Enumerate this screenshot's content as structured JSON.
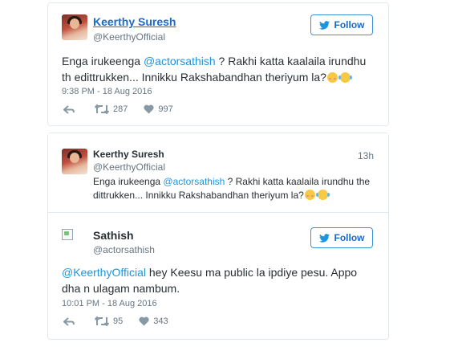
{
  "tweet1": {
    "name": "Keerthy Suresh",
    "handle": "@KeerthyOfficial",
    "follow_label": "Follow",
    "text_before": "Enga irukeenga ",
    "mention": "@actorsathish",
    "text_after": " ? Rakhi katta kaalaila irundhu th edittrukken... Innikku Rakshabandhan theriyum la?",
    "timestamp": "9:38 PM - 18 Aug 2016",
    "retweets": "287",
    "likes": "997"
  },
  "tweet2": {
    "quoted": {
      "name": "Keerthy Suresh",
      "handle": "@KeerthyOfficial",
      "relative_time": "13h",
      "text_before": "Enga irukeenga ",
      "mention": "@actorsathish",
      "text_after": " ? Rakhi katta kaalaila irundhu the dittrukken... Innikku Rakshabandhan theriyum la?"
    },
    "reply": {
      "name": "Sathish",
      "handle": "@actorsathish",
      "follow_label": "Follow",
      "mention": "@KeerthyOfficial",
      "text_after": " hey Keesu ma public la ipdiye pesu. Appo dha n ulagam nambum.",
      "timestamp": "10:01 PM - 18 Aug 2016",
      "retweets": "95",
      "likes": "343"
    }
  },
  "colors": {
    "link_blue": "#1b95e0",
    "follow_blue": "#1b6ac9",
    "muted_gray": "#66757f",
    "border": "#e1e8ed"
  },
  "icons": [
    "reply-icon",
    "retweet-icon",
    "heart-icon",
    "twitter-bird-icon",
    "grinning-face-emoji",
    "tears-of-joy-emoji"
  ]
}
